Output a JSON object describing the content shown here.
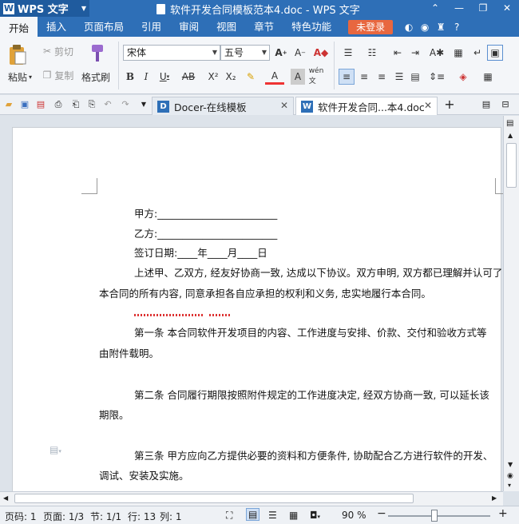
{
  "app": {
    "name": "WPS 文字",
    "window_title": "软件开发合同模板范本4.doc - WPS 文字"
  },
  "menu": {
    "tabs": [
      "开始",
      "插入",
      "页面布局",
      "引用",
      "审阅",
      "视图",
      "章节",
      "特色功能"
    ],
    "login_label": "未登录"
  },
  "ribbon": {
    "paste_label": "粘贴",
    "cut_label": "剪切",
    "copy_label": "复制",
    "format_painter_label": "格式刷",
    "font_name": "宋体",
    "font_size": "五号",
    "bold": "B",
    "italic": "I",
    "underline": "U",
    "strikethrough": "AB",
    "superscript": "X²",
    "subscript": "X₂"
  },
  "tabs": [
    {
      "label": "Docer-在线模板",
      "icon": "docer-icon"
    },
    {
      "label": "软件开发合同...本4.doc",
      "icon": "word-doc-icon"
    }
  ],
  "document": {
    "party_a": "甲方:________________________",
    "party_b": "乙方:________________________",
    "sign_date": "签订日期:____年____月____日",
    "intro_1": "上述甲、乙双方, 经友好协商一致, 达成以下协议。双方申明, 双方都已理解并认可了",
    "intro_2": "本合同的所有内容, 同意承担各自应承担的权利和义务, 忠实地履行本合同。",
    "art1_1": "第一条   本合同软件开发项目的内容、工作进度与安排、价款、交付和验收方式等",
    "art1_2": "由附件载明。",
    "art2_1": "第二条   合同履行期限按照附件规定的工作进度决定, 经双方协商一致, 可以延长该",
    "art2_2": "期限。",
    "art3_1": "第三条   甲方应向乙方提供必要的资料和方便条件, 协助配合乙方进行软件的开发、",
    "art3_2": "调试、安装及实施。"
  },
  "status": {
    "page_num": "页码: 1",
    "pages": "页面: 1/3",
    "section": "节: 1/1",
    "row": "行: 13",
    "col": "列: 1",
    "zoom": "90 %"
  },
  "colors": {
    "title_bar": "#2e6fb7",
    "login_button": "#e8673f",
    "accent": "#2e6fb7"
  }
}
